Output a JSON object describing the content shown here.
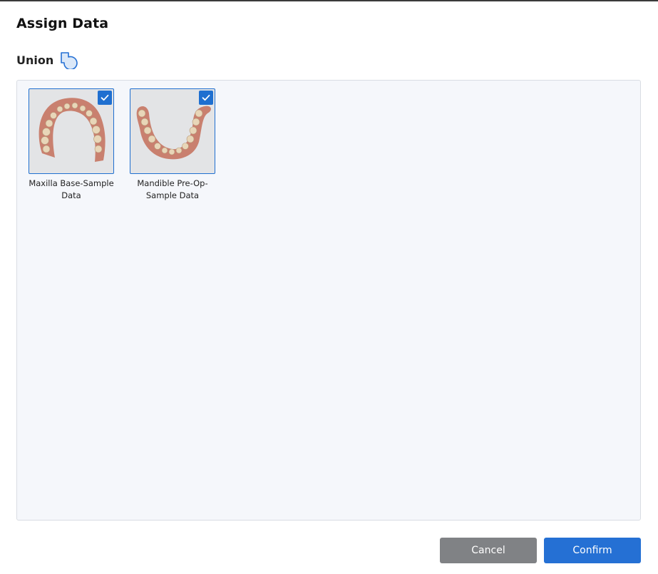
{
  "dialog": {
    "title": "Assign Data",
    "section_label": "Union",
    "section_icon": "union-shape-icon"
  },
  "items": [
    {
      "label": "Maxilla Base-Sample Data",
      "checked": true,
      "thumbnail": "maxilla-scan-thumbnail"
    },
    {
      "label": "Mandible Pre-Op-Sample Data",
      "checked": true,
      "thumbnail": "mandible-scan-thumbnail"
    }
  ],
  "buttons": {
    "cancel": "Cancel",
    "confirm": "Confirm"
  },
  "colors": {
    "accent": "#2570d4",
    "cancel": "#808285",
    "panel_bg": "#f5f7fb",
    "selection_border": "#1f6fd0"
  }
}
